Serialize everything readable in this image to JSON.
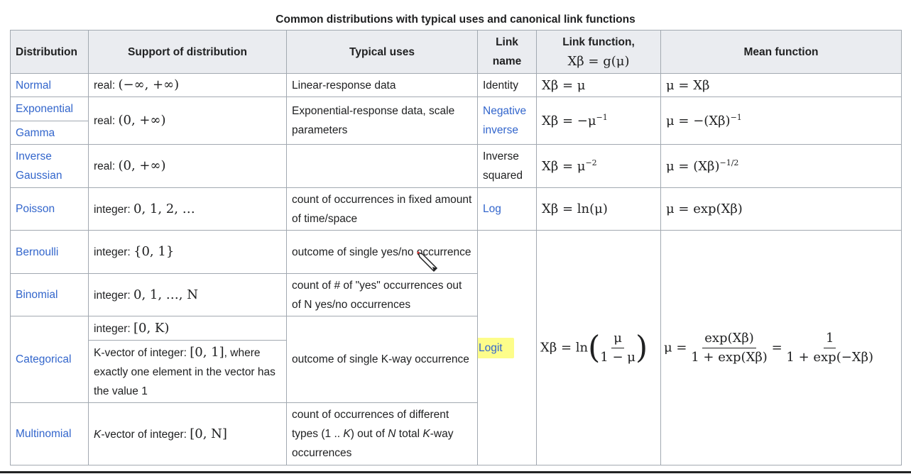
{
  "caption": "Common distributions with typical uses and canonical link functions",
  "headers": {
    "distribution": "Distribution",
    "support": "Support of distribution",
    "uses": "Typical uses",
    "link_name_1": "Link",
    "link_name_2": "name",
    "link_fn_1": "Link function,",
    "link_fn_formula": "Xβ = g(μ)",
    "mean_fn": "Mean function"
  },
  "rows": {
    "normal": {
      "name": "Normal",
      "support_prefix": "real: ",
      "support_math": "(−∞, +∞)",
      "uses": "Linear-response data",
      "link": "Identity",
      "link_fn": "Xβ = μ",
      "mean": "μ = Xβ"
    },
    "exponential": {
      "name": "Exponential"
    },
    "gamma": {
      "name": "Gamma",
      "support_prefix": "real: ",
      "support_math": "(0, +∞)",
      "uses": "Exponential-response data, scale parameters",
      "link_1": "Negative",
      "link_2": "inverse",
      "link_fn": "Xβ = −μ",
      "link_fn_exp": "−1",
      "mean": "μ = −(Xβ)",
      "mean_exp": "−1"
    },
    "inverse_gaussian": {
      "name_1": "Inverse",
      "name_2": "Gaussian",
      "support_prefix": "real: ",
      "support_math": "(0, +∞)",
      "uses": "",
      "link_1": "Inverse",
      "link_2": "squared",
      "link_fn": "Xβ = μ",
      "link_fn_exp": "−2",
      "mean": "μ = (Xβ)",
      "mean_exp": "−1/2"
    },
    "poisson": {
      "name": "Poisson",
      "support_prefix": "integer: ",
      "support_math": "0, 1, 2, …",
      "uses": "count of occurrences in fixed amount of time/space",
      "link": "Log",
      "link_fn": "Xβ = ln(μ)",
      "mean": "μ = exp(Xβ)"
    },
    "bernoulli": {
      "name": "Bernoulli",
      "support_prefix": "integer: ",
      "support_math": "{0, 1}",
      "uses": "outcome of single yes/no occurrence"
    },
    "binomial": {
      "name": "Binomial",
      "support_prefix": "integer: ",
      "support_math": "0, 1, …, N",
      "uses": "count of # of \"yes\" occurrences out of N yes/no occurrences"
    },
    "categorical": {
      "name": "Categorical",
      "support_a_prefix": "integer: ",
      "support_a_math": "[0, K)",
      "support_b_prefix": "K-vector of integer: ",
      "support_b_math": "[0, 1]",
      "support_b_suffix": ", where exactly one element in the vector has the value 1",
      "uses": "outcome of single K-way occurrence",
      "link": "Logit",
      "link_fn_lhs": "Xβ = ln",
      "link_fn_num": "μ",
      "link_fn_den": "1 − μ",
      "mean_lhs": "μ =",
      "mean_num1": "exp(Xβ)",
      "mean_den1": "1 + exp(Xβ)",
      "mean_eq": "=",
      "mean_num2": "1",
      "mean_den2": "1 + exp(−Xβ)"
    },
    "multinomial": {
      "name": "Multinomial",
      "support_k": "K",
      "support_prefix": "-vector of integer: ",
      "support_math": "[0, N]",
      "uses_1": "count of occurrences of different types (1 .. ",
      "uses_k": "K",
      "uses_2": ") out of ",
      "uses_n": "N",
      "uses_3": " total ",
      "uses_k2": "K",
      "uses_4": "-way occurrences"
    }
  }
}
